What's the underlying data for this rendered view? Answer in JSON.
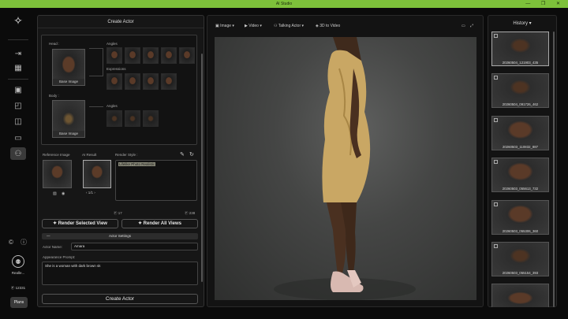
{
  "app": {
    "title": "AI Studio",
    "window_controls": "— ❐ ✕"
  },
  "sidebar": {
    "user_name": "Realle...",
    "credits": "12331",
    "plans_label": "Plans"
  },
  "create_panel": {
    "title": "Create Actor",
    "head_label": "Head :",
    "body_label": "Body :",
    "angles_label": "Angles",
    "expressions_label": "Expressions",
    "angles2_label": "Angles",
    "base_image_label": "Base Image",
    "base_image_label2": "Base Image",
    "reference_image_label": "Reference Image",
    "ai_result_label": "AI Result",
    "render_style_label": "Render Style :",
    "render_style_value": "Lifelike Photo Realistic",
    "pager": "1/1",
    "count_left": "17",
    "count_right": "238",
    "render_selected_label": "Render Selected View",
    "render_all_label": "Render All Views",
    "actor_settings_label": "Actor Settings",
    "actor_name_label": "Actor Name:",
    "actor_name_value": "Amara",
    "appearance_label": "Appearance Prompt:",
    "appearance_value": "She is a woman with dark brown sk",
    "create_button": "Create Actor"
  },
  "toolbar": {
    "image_label": "Image ▾",
    "video_label": "Video ▾",
    "talking_actor_label": "Talking Actor ▾",
    "to_video_label": "3D to Video"
  },
  "history": {
    "title": "History ▾",
    "items": [
      "20260504_121903_435",
      "20260504_091726_462",
      "20260503_110832_887",
      "20260503_055613_732",
      "20260503_055306_360",
      "20260503_055154_393"
    ]
  },
  "colors": {
    "accent": "#7dc13a",
    "dress": "#c9a764",
    "skin": "#5b3b28"
  }
}
